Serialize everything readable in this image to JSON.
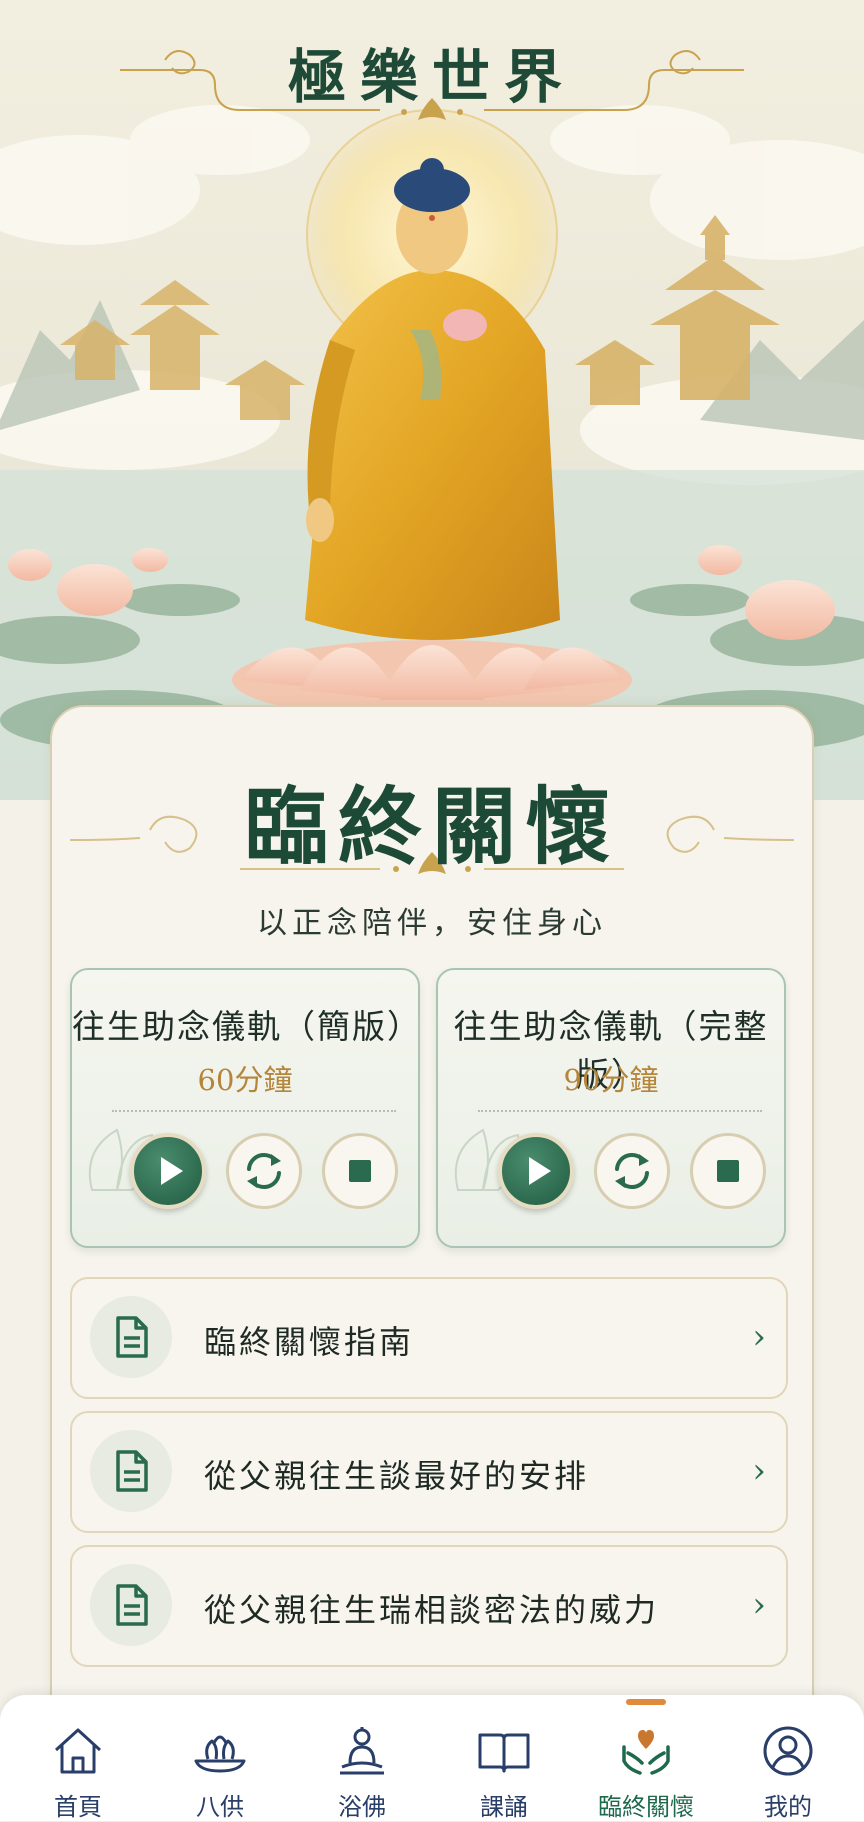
{
  "app": {
    "title": "極樂世界"
  },
  "section": {
    "title": "臨終關懷",
    "subtitle": "以正念陪伴，安住身心"
  },
  "cards": [
    {
      "title": "往生助念儀軌（簡版）",
      "duration": "60分鐘"
    },
    {
      "title": "往生助念儀軌（完整版）",
      "duration": "90分鐘"
    }
  ],
  "list": [
    {
      "label": "臨終關懷指南",
      "icon": "document-icon"
    },
    {
      "label": "從父親往生談最好的安排",
      "icon": "document-icon"
    },
    {
      "label": "從父親往生瑞相談密法的威力",
      "icon": "document-icon"
    }
  ],
  "tabs": [
    {
      "label": "首頁",
      "icon": "home-icon"
    },
    {
      "label": "八供",
      "icon": "offering-icon"
    },
    {
      "label": "浴佛",
      "icon": "buddha-icon"
    },
    {
      "label": "課誦",
      "icon": "book-icon"
    },
    {
      "label": "臨終關懷",
      "icon": "care-hands-icon",
      "active": true
    },
    {
      "label": "我的",
      "icon": "user-icon"
    }
  ],
  "colors": {
    "accent": "#1f5c42",
    "gold": "#b5853a",
    "active_indicator": "#e08a3c"
  }
}
